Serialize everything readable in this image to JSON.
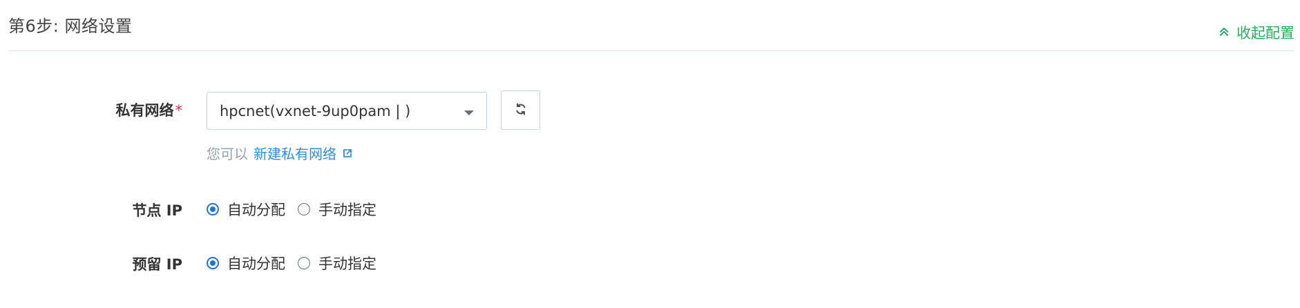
{
  "header": {
    "step_title": "第6步: 网络设置",
    "collapse_label": "收起配置"
  },
  "private_network": {
    "label": "私有网络",
    "required_mark": "*",
    "selected_value": "hpcnet(vxnet-9up0pam | )",
    "hint_prefix": "您可以",
    "hint_link": "新建私有网络"
  },
  "node_ip": {
    "label": "节点 IP",
    "options": [
      "自动分配",
      "手动指定"
    ],
    "selected": "自动分配"
  },
  "reserved_ip": {
    "label": "预留 IP",
    "options": [
      "自动分配",
      "手动指定"
    ],
    "selected": "自动分配"
  },
  "colors": {
    "accent_green": "#22b15a",
    "link_blue": "#2f8de4",
    "radio_blue": "#1a73e8",
    "required_red": "#e0383e"
  },
  "icons": {
    "collapse": "double-chevron-up-icon",
    "dropdown": "caret-down-icon",
    "refresh": "refresh-icon",
    "external_link": "external-link-icon"
  }
}
